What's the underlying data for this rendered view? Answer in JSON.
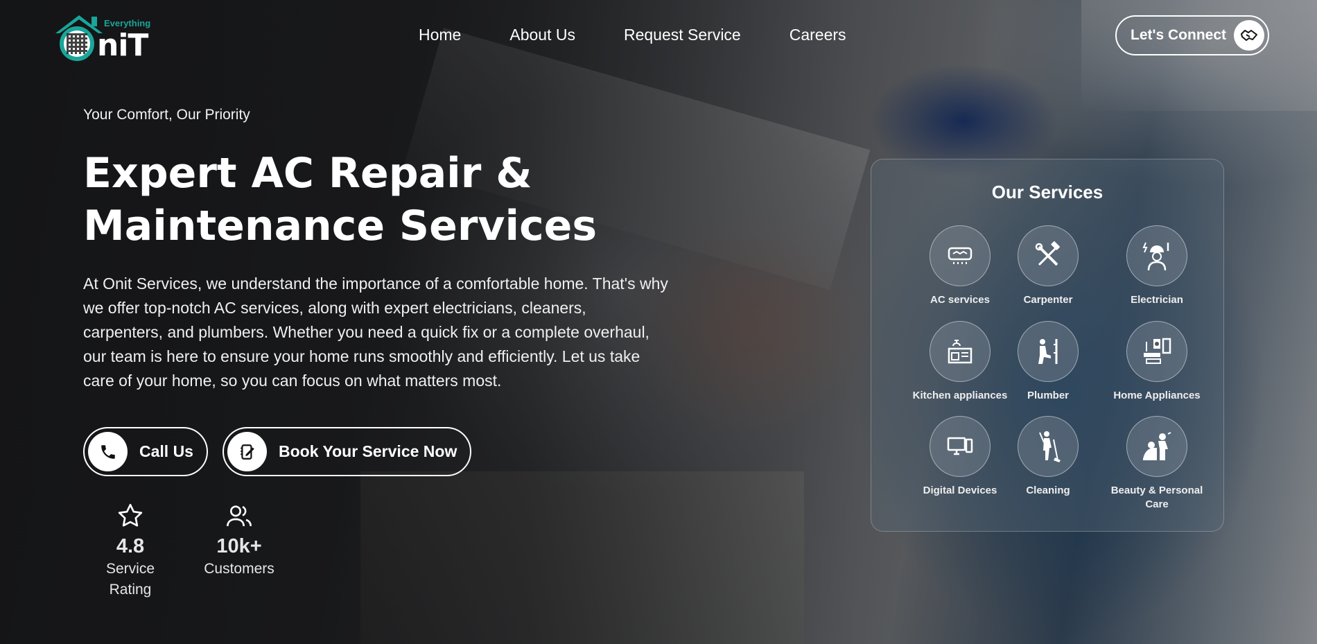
{
  "brand": {
    "tagline_small": "Everything",
    "name": "OniT"
  },
  "nav": {
    "items": [
      {
        "label": "Home"
      },
      {
        "label": "About Us"
      },
      {
        "label": "Request Service"
      },
      {
        "label": "Careers"
      }
    ],
    "connect_label": "Let's Connect"
  },
  "hero": {
    "tagline": "Your Comfort, Our Priority",
    "title_line1": "Expert AC Repair &",
    "title_line2": "Maintenance Services",
    "description_lines": [
      "At Onit Services, we understand the importance of a comfortable home. That's why",
      "we offer top-notch AC services, along with expert electricians, cleaners,",
      "carpenters, and plumbers. Whether you need a quick fix or a complete overhaul,",
      "our team is here to ensure your home runs smoothly and efficiently. Let us take",
      "care of your home, so you can focus on what matters most."
    ],
    "call_label": "Call Us",
    "book_label": "Book Your Service Now"
  },
  "stats": [
    {
      "value": "4.8",
      "label": "Service Rating",
      "icon": "star-icon"
    },
    {
      "value": "10k+",
      "label": "Customers",
      "icon": "users-icon"
    }
  ],
  "services": {
    "title": "Our Services",
    "items": [
      {
        "label": "AC services",
        "icon": "ac-unit-icon"
      },
      {
        "label": "Carpenter",
        "icon": "tools-icon"
      },
      {
        "label": "Electrician",
        "icon": "electrician-icon"
      },
      {
        "label": "Kitchen appliances",
        "icon": "kitchen-icon"
      },
      {
        "label": "Plumber",
        "icon": "plumber-icon"
      },
      {
        "label": "Home Appliances",
        "icon": "appliances-icon"
      },
      {
        "label": "Digital Devices",
        "icon": "devices-icon"
      },
      {
        "label": "Cleaning",
        "icon": "cleaning-icon"
      },
      {
        "label": "Beauty & Personal Care",
        "icon": "beauty-icon"
      }
    ]
  }
}
